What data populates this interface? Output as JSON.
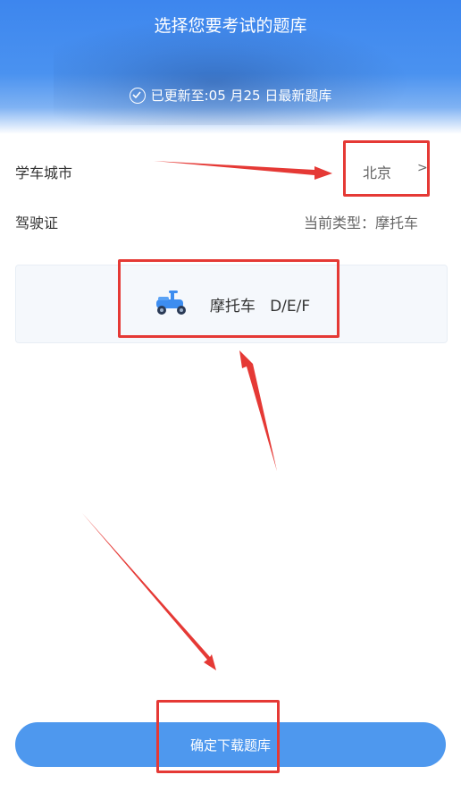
{
  "header": {
    "title": "选择您要考试的题库",
    "update_text": "已更新至:05 月25 日最新题库"
  },
  "city_row": {
    "label": "学车城市",
    "value": "北京",
    "chevron": ">"
  },
  "license_row": {
    "label": "驾驶证",
    "value": "当前类型：摩托车"
  },
  "vehicle": {
    "label": "摩托车   D/E/F",
    "icon": "scooter-icon"
  },
  "confirm_button": {
    "label": "确定下载题库"
  },
  "colors": {
    "header_blue": "#3d86ee",
    "button_blue": "#4e98ee",
    "annotation_red": "#e53935"
  }
}
